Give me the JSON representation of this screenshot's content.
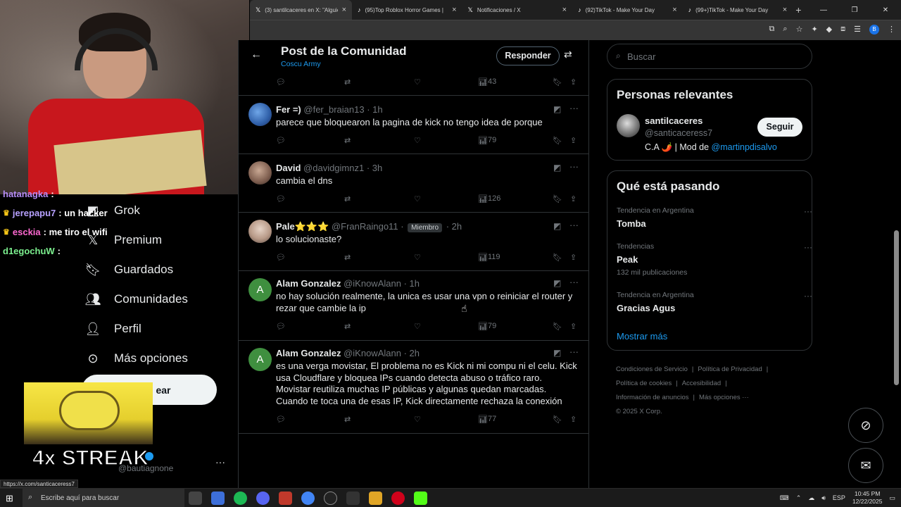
{
  "browser": {
    "tabs": [
      {
        "label": "(3) santilcaceres en X: \"Alguien",
        "icon": "x-icon",
        "active": true
      },
      {
        "label": "(95)Top Roblox Horror Games |",
        "icon": "tiktok-icon",
        "active": false
      },
      {
        "label": "Notificaciones / X",
        "icon": "x-icon",
        "active": false
      },
      {
        "label": "(92)TikTok - Make Your Day",
        "icon": "tiktok-icon",
        "active": false
      },
      {
        "label": "(99+)TikTok - Make Your Day",
        "icon": "tiktok-icon",
        "active": false
      }
    ],
    "new_tab": "+",
    "profile_initial": "B",
    "status_url": "https://x.com/santicaceress7"
  },
  "stream_chat": [
    {
      "user": "hatanagka",
      "msg": ":",
      "color": "#b58cf7"
    },
    {
      "user": "jerepapu7",
      "msg": ": un hacker",
      "color": "#b7a1ff"
    },
    {
      "user": "esckia",
      "msg": ": me tiro el wifi",
      "color": "#ff69d2"
    },
    {
      "user": "d1egochuW",
      "msg": ":",
      "color": "#7cf08f"
    }
  ],
  "left_nav": {
    "items": [
      {
        "label": "Grok",
        "icon": "grok-icon"
      },
      {
        "label": "Premium",
        "icon": "x-premium-icon"
      },
      {
        "label": "Guardados",
        "icon": "bookmark-icon"
      },
      {
        "label": "Comunidades",
        "icon": "communities-icon"
      },
      {
        "label": "Perfil",
        "icon": "profile-icon"
      },
      {
        "label": "Más opciones",
        "icon": "more-options-icon"
      }
    ],
    "post_button_visible": "ear",
    "streak_overlay": "4x STREAK",
    "account_handle": "@bautiagnone"
  },
  "header": {
    "title": "Post de la Comunidad",
    "subtitle": "Coscu Army",
    "reply_button": "Responder"
  },
  "posts": [
    {
      "views": "43",
      "partial": true
    },
    {
      "name": "Fer =)",
      "handle": "@fer_braian13",
      "time": "· 1h",
      "text": "parece que bloquearon la pagina de kick no tengo idea de porque",
      "views": "79",
      "avatar_color": "#3a6fb3"
    },
    {
      "name": "David",
      "handle": "@davidgimnz1",
      "time": "· 3h",
      "text": "cambia el dns",
      "views": "126",
      "avatar_color": "#8a6d5e"
    },
    {
      "name": "Pale⭐⭐⭐",
      "handle": "@FranRaingo11",
      "badge": "Miembro",
      "time": "· 2h",
      "text": "lo solucionaste?",
      "views": "119",
      "avatar_color": "#b8a090"
    },
    {
      "name": "Alam Gonzalez",
      "handle": "@iKnowAlann",
      "time": "· 1h",
      "text": "no hay solución realmente, la unica es usar una vpn o reiniciar el router y rezar que cambie la ip",
      "views": "79",
      "avatar_letter": "A",
      "avatar_color": "#3f8f3f"
    },
    {
      "name": "Alam Gonzalez",
      "handle": "@iKnowAlann",
      "time": "· 2h",
      "text": "es una verga movistar, El problema no es Kick ni mi compu ni el celu. Kick usa Cloudflare y bloquea IPs cuando detecta abuso o tráfico raro. Movistar reutiliza muchas IP públicas y algunas quedan marcadas. Cuando te toca una de esas IP, Kick directamente rechaza la conexión",
      "views": "77",
      "avatar_letter": "A",
      "avatar_color": "#3f8f3f"
    }
  ],
  "right": {
    "search_placeholder": "Buscar",
    "relevant": {
      "title": "Personas relevantes",
      "name": "santilcaceres",
      "handle": "@santicaceress7",
      "bio_prefix": "C.A 🌶️ | Mod de ",
      "bio_link": "@martinpdisalvo",
      "follow": "Seguir"
    },
    "trends": {
      "title": "Qué está pasando",
      "items": [
        {
          "meta": "Tendencia en Argentina",
          "name": "Tomba",
          "count": ""
        },
        {
          "meta": "Tendencias",
          "name": "Peak",
          "count": "132 mil publicaciones"
        },
        {
          "meta": "Tendencia en Argentina",
          "name": "Gracias Agus",
          "count": ""
        }
      ],
      "show_more": "Mostrar más"
    },
    "footer": {
      "links": [
        "Condiciones de Servicio",
        "|",
        "Política de Privacidad",
        "|",
        "Política de cookies",
        "|",
        "Accesibilidad",
        "|",
        "Información de anuncios",
        "|",
        "Más opciones ···"
      ],
      "copyright": "© 2025 X Corp."
    }
  },
  "taskbar": {
    "search_text": "Escribe aquí para buscar",
    "lang": "ESP",
    "time": "10:45 PM",
    "date": "12/22/2025"
  }
}
